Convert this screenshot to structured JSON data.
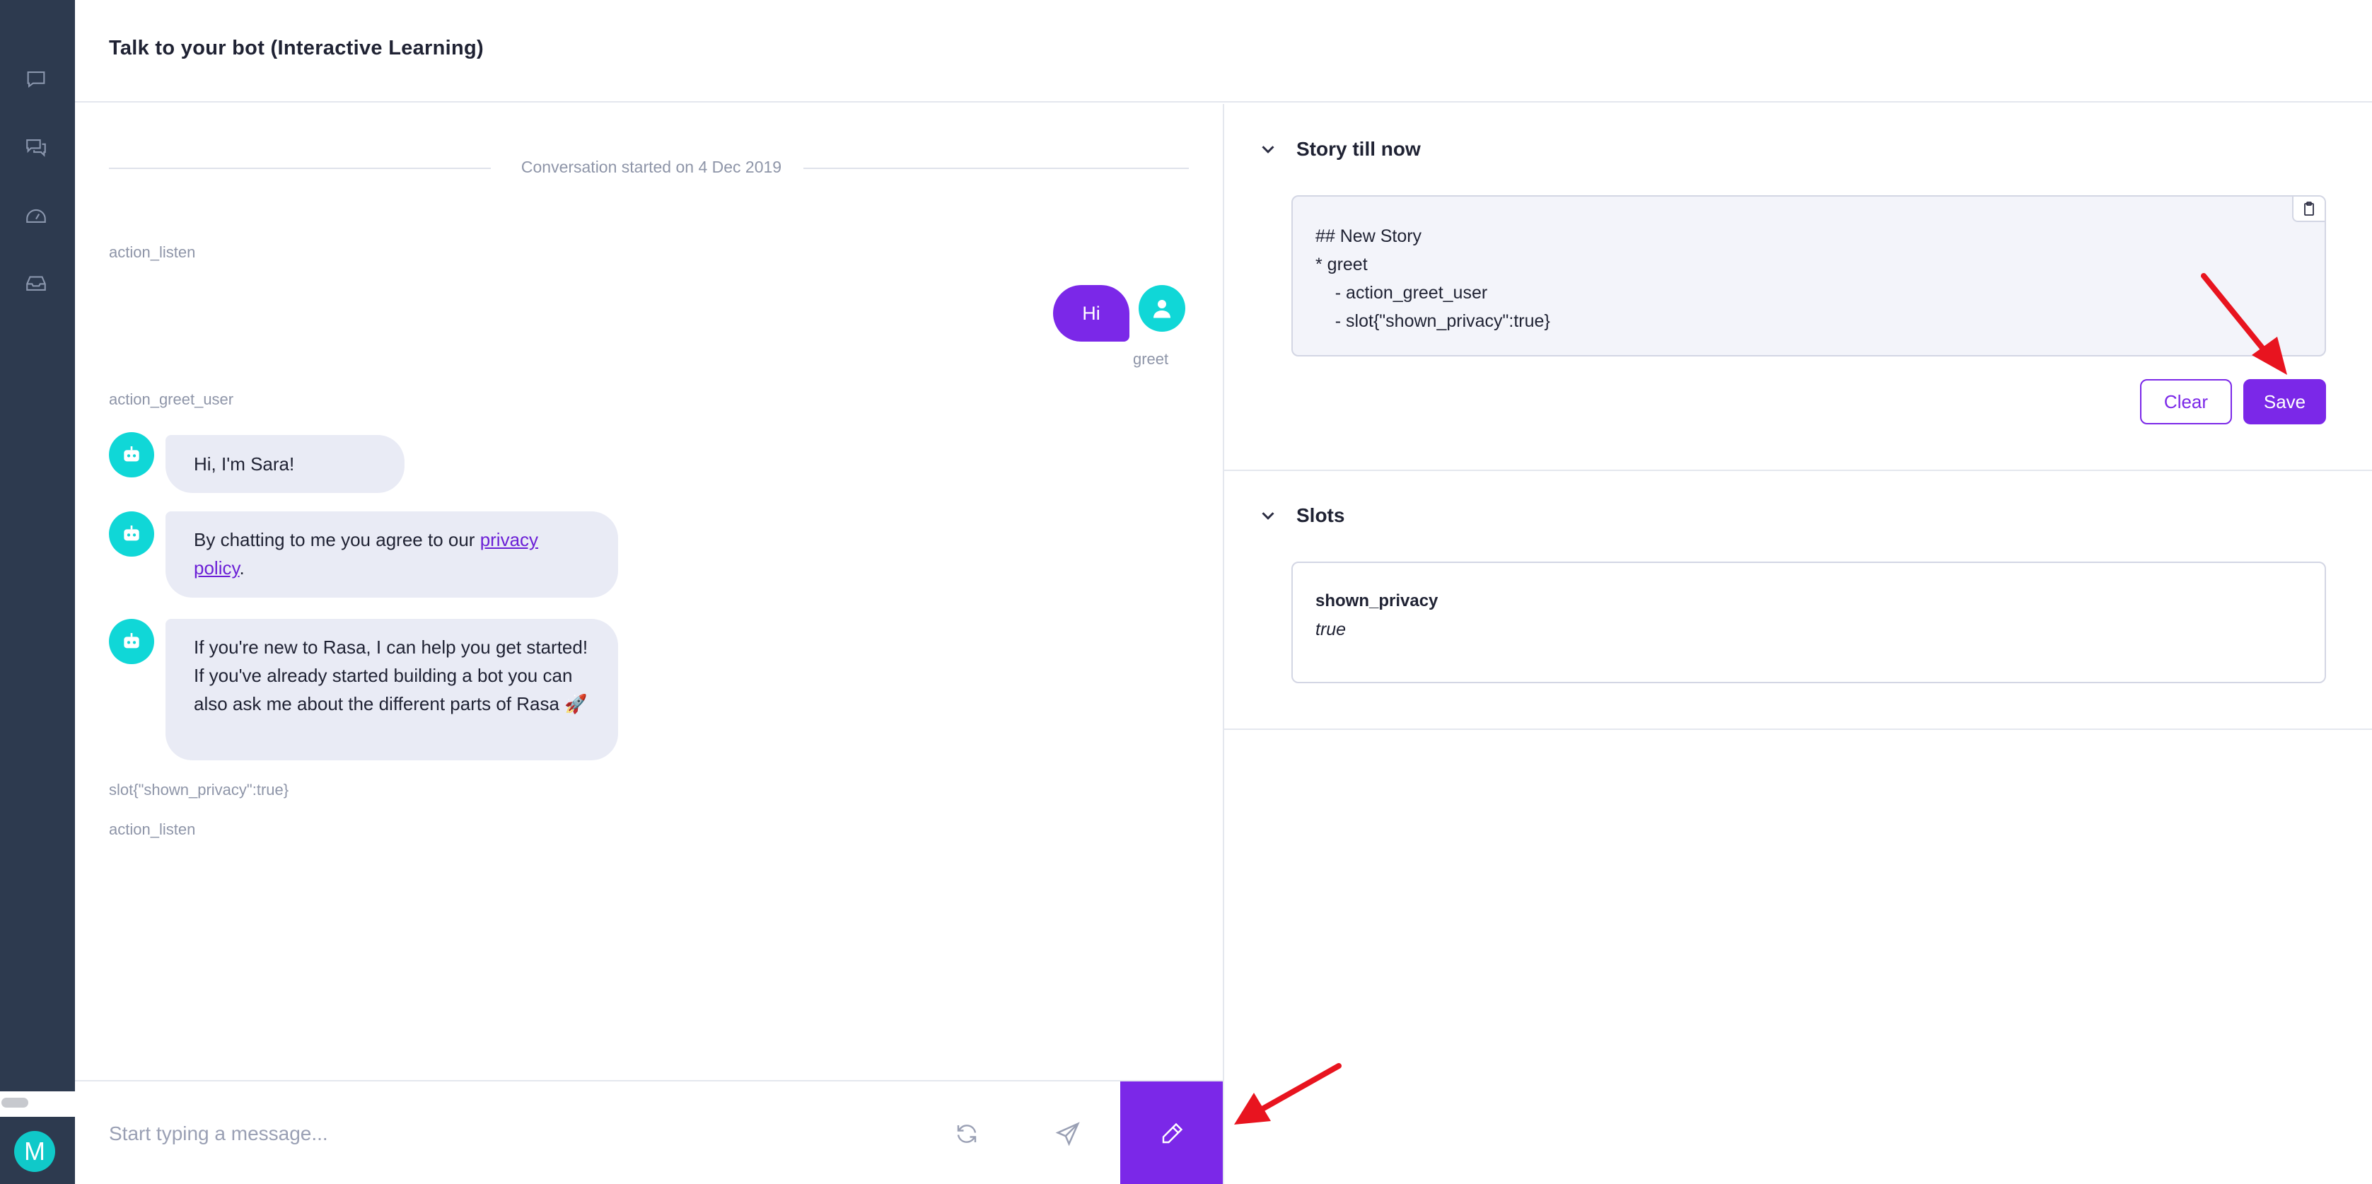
{
  "header": {
    "title": "Talk to your bot (Interactive Learning)"
  },
  "sidebar": {
    "icons": [
      "chat-icon",
      "conversations-icon",
      "dashboard-icon",
      "inbox-icon"
    ],
    "avatar_initial": "M"
  },
  "chat": {
    "conversation_started": "Conversation started on 4 Dec 2019",
    "actions": {
      "first_listen": "action_listen",
      "greet_user": "action_greet_user",
      "slot_event": "slot{\"shown_privacy\":true}",
      "last_listen": "action_listen"
    },
    "user_message": "Hi",
    "user_intent": "greet",
    "bot_messages": {
      "m1": "Hi, I'm Sara!",
      "m2_prefix": "By chatting to me you agree to our ",
      "m2_link": "privacy policy",
      "m2_suffix": ".",
      "m3": "If you're new to Rasa, I can help you get started! If you've already started building a bot you can also ask me about the different parts of Rasa 🚀"
    }
  },
  "composer": {
    "placeholder": "Start typing a message..."
  },
  "story": {
    "title": "Story till now",
    "lines": [
      "## New Story",
      "* greet",
      "    - action_greet_user",
      "    - slot{\"shown_privacy\":true}"
    ],
    "clear_label": "Clear",
    "save_label": "Save"
  },
  "slots": {
    "title": "Slots",
    "items": [
      {
        "name": "shown_privacy",
        "value": "true"
      }
    ]
  },
  "colors": {
    "accent": "#7b28e8",
    "sidebar": "#2d3a4f",
    "avatar": "#10d7d7",
    "annotation_arrow": "#e8141f"
  }
}
